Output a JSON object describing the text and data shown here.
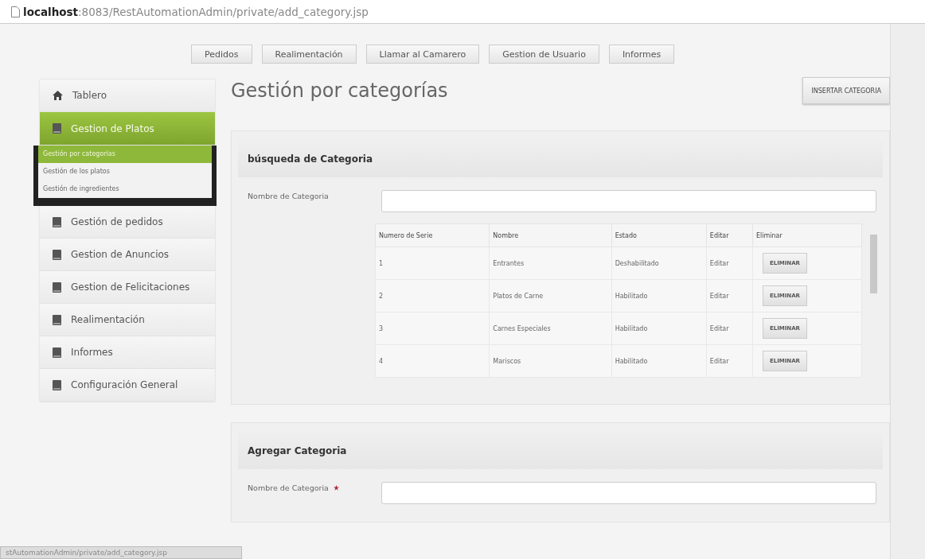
{
  "address_bar": {
    "host": "localhost",
    "path": ":8083/RestAutomationAdmin/private/add_category.jsp"
  },
  "top_nav": [
    {
      "label": "Pedidos"
    },
    {
      "label": "Realimentación"
    },
    {
      "label": "Llamar al Camarero"
    },
    {
      "label": "Gestion de Usuario"
    },
    {
      "label": "Informes"
    }
  ],
  "sidebar": {
    "items": [
      {
        "label": "Tablero",
        "kind": "home",
        "selected": false
      },
      {
        "label": "Gestion de Platos",
        "kind": "book",
        "selected": true,
        "children": [
          {
            "label": "Gestión por categorías",
            "selected": true
          },
          {
            "label": "Gestión de los platos",
            "selected": false
          },
          {
            "label": "Gestión de ingredientes",
            "selected": false
          }
        ]
      },
      {
        "label": "Gestión de pedidos",
        "kind": "book",
        "selected": false
      },
      {
        "label": "Gestion de Anuncios",
        "kind": "book",
        "selected": false
      },
      {
        "label": "Gestion de Felicitaciones",
        "kind": "book",
        "selected": false
      },
      {
        "label": "Realimentación",
        "kind": "book",
        "selected": false
      },
      {
        "label": "Informes",
        "kind": "book",
        "selected": false
      },
      {
        "label": "Configuración General",
        "kind": "book",
        "selected": false
      }
    ]
  },
  "page_title": "Gestión por categorías",
  "insert_button": "INSERTAR CATEGORIA",
  "search_panel": {
    "title": "búsqueda de Categoria",
    "field_label": "Nombre de Categoria",
    "table": {
      "columns": [
        "Numero de Serie",
        "Nombre",
        "Estado",
        "Editar",
        "Eliminar"
      ],
      "rows": [
        {
          "number": "1",
          "name": "Entrantes",
          "status": "Deshabilitado",
          "edit": "Editar",
          "delete": "ELIMINAR"
        },
        {
          "number": "2",
          "name": "Platos de Carne",
          "status": "Habilitado",
          "edit": "Editar",
          "delete": "ELIMINAR"
        },
        {
          "number": "3",
          "name": "Carnes Especiales",
          "status": "Habilitado",
          "edit": "Editar",
          "delete": "ELIMINAR"
        },
        {
          "number": "4",
          "name": "Mariscos",
          "status": "Habilitado",
          "edit": "Editar",
          "delete": "ELIMINAR"
        }
      ]
    }
  },
  "add_panel": {
    "title": "Agregar Categoria",
    "field_label": "Nombre de Categoria",
    "required": true
  },
  "status_bar": "stAutomationAdmin/private/add_category.jsp"
}
